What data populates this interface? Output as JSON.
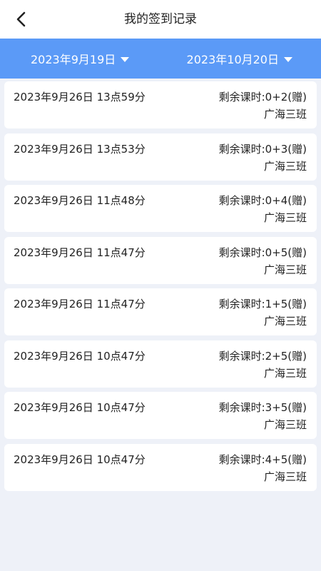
{
  "header": {
    "title": "我的签到记录",
    "back_icon": "chevron-left-icon"
  },
  "filter": {
    "start_date": "2023年9月19日",
    "end_date": "2023年10月20日",
    "caret_icon": "caret-down-icon",
    "bar_color": "#5b9af7"
  },
  "records": [
    {
      "time": "2023年9月26日 13点59分",
      "remaining": "剩余课时:0+2(赠)",
      "class_name": "广海三班"
    },
    {
      "time": "2023年9月26日 13点53分",
      "remaining": "剩余课时:0+3(赠)",
      "class_name": "广海三班"
    },
    {
      "time": "2023年9月26日 11点48分",
      "remaining": "剩余课时:0+4(赠)",
      "class_name": "广海三班"
    },
    {
      "time": "2023年9月26日 11点47分",
      "remaining": "剩余课时:0+5(赠)",
      "class_name": "广海三班"
    },
    {
      "time": "2023年9月26日 11点47分",
      "remaining": "剩余课时:1+5(赠)",
      "class_name": "广海三班"
    },
    {
      "time": "2023年9月26日 10点47分",
      "remaining": "剩余课时:2+5(赠)",
      "class_name": "广海三班"
    },
    {
      "time": "2023年9月26日 10点47分",
      "remaining": "剩余课时:3+5(赠)",
      "class_name": "广海三班"
    },
    {
      "time": "2023年9月26日 10点47分",
      "remaining": "剩余课时:4+5(赠)",
      "class_name": "广海三班"
    }
  ]
}
